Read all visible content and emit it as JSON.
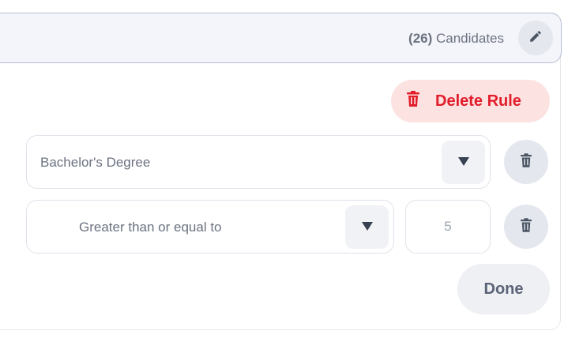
{
  "header": {
    "candidates_count": "(26)",
    "candidates_label": " Candidates",
    "edit_icon": "pencil-icon"
  },
  "rule": {
    "delete_label": "Delete Rule",
    "delete_icon": "trash-icon",
    "colors": {
      "delete_text": "#e11d2a",
      "delete_bg": "#fde2e2"
    }
  },
  "conditions": [
    {
      "field_value": "Bachelor's Degree",
      "remove_icon": "trash-icon"
    },
    {
      "operator_value": "Greater than or equal to",
      "number_value": "5",
      "remove_icon": "trash-icon"
    }
  ],
  "actions": {
    "done_label": "Done"
  }
}
